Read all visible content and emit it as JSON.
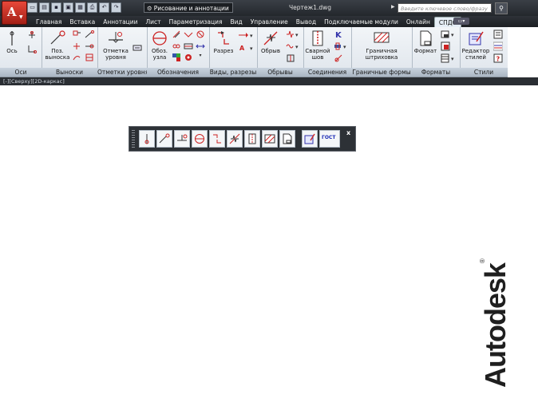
{
  "titlebar": {
    "workspace": "Рисование и аннотации",
    "document_title": "Чертеж1.dwg",
    "search_placeholder": "Введите ключевое слово/фразу",
    "qat_icons": [
      "new-icon",
      "open-icon",
      "save-icon",
      "save-as-icon",
      "plot-icon",
      "print-icon",
      "undo-icon",
      "redo-icon"
    ]
  },
  "tabs": [
    {
      "label": "Главная",
      "active": false
    },
    {
      "label": "Вставка",
      "active": false
    },
    {
      "label": "Аннотации",
      "active": false
    },
    {
      "label": "Лист",
      "active": false
    },
    {
      "label": "Параметризация",
      "active": false
    },
    {
      "label": "Вид",
      "active": false
    },
    {
      "label": "Управление",
      "active": false
    },
    {
      "label": "Вывод",
      "active": false
    },
    {
      "label": "Подключаемые модули",
      "active": false
    },
    {
      "label": "Онлайн",
      "active": false
    },
    {
      "label": "СПДС",
      "active": true
    }
  ],
  "ribbon": {
    "panels": {
      "axes": {
        "title": "Оси",
        "big": "Ось"
      },
      "leaders": {
        "title": "Выноски",
        "big": "Поз. выноска"
      },
      "levels": {
        "title": "Отметки уровня",
        "big": "Отметка уровня"
      },
      "symbols": {
        "title": "Обозначения",
        "big": "Обоз. узла"
      },
      "views": {
        "title": "Виды, разрезы",
        "big": "Разрез"
      },
      "breaks": {
        "title": "Обрывы",
        "big": "Обрыв"
      },
      "joints": {
        "title": "Соединения",
        "big": "Сварной шов"
      },
      "boundary": {
        "title": "Граничные формы",
        "big": "Граничная штриховка"
      },
      "formats": {
        "title": "Форматы",
        "big": "Формат"
      },
      "styles": {
        "title": "Стили",
        "big": "Редактор стилей"
      }
    }
  },
  "subbar_text": "[-][Сверху][2D-каркас]",
  "floating_toolbar": {
    "gost_label": "ГОСТ",
    "close_label": "x"
  },
  "logo": {
    "text": "Autodesk",
    "reg": "®"
  },
  "colors": {
    "accent_red": "#d0261a",
    "ribbon_bg": "#e6ecf2",
    "dark_bar": "#2a2e33"
  }
}
